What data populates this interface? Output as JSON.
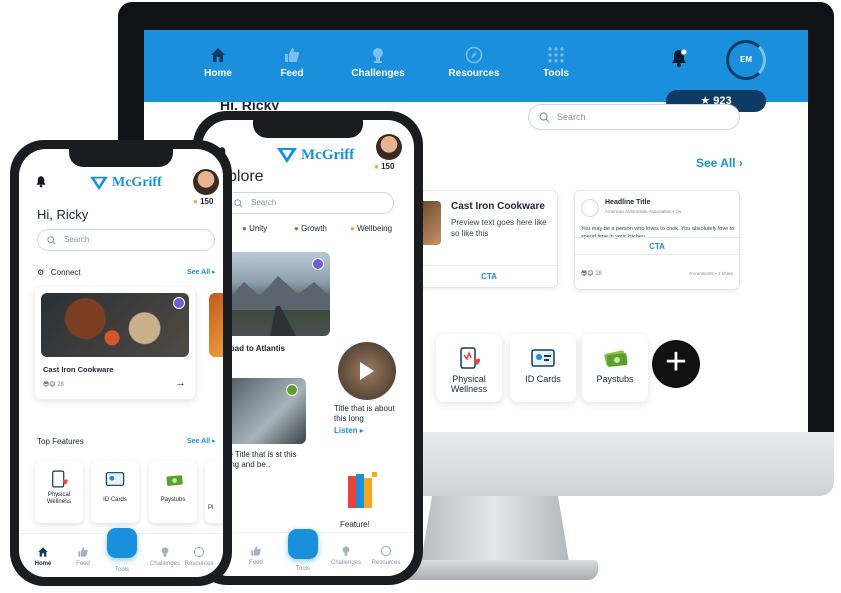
{
  "desktop": {
    "nav": [
      {
        "label": "Home",
        "icon": "home-icon"
      },
      {
        "label": "Feed",
        "icon": "thumbs-up-icon"
      },
      {
        "label": "Challenges",
        "icon": "trophy-icon"
      },
      {
        "label": "Resources",
        "icon": "compass-icon"
      },
      {
        "label": "Tools",
        "icon": "grid-icon"
      }
    ],
    "avatar_initials": "EM",
    "points": "923",
    "greeting_partial": "Hi, Ricky",
    "search_placeholder": "Search",
    "see_all": "See All",
    "card1": {
      "title": "Cast Iron Cookware",
      "preview": "Preview text goes here like so like this",
      "cta": "CTA"
    },
    "card2": {
      "headline": "Headline Title",
      "source": "American Automobile Association • 1w",
      "body": "You may be a person who loves to cook. You absolutely love to spend time in your kitchen...",
      "reaction_count": "28",
      "stats": "0 comments • 1 share",
      "cta": "CTA"
    },
    "features": [
      {
        "label": "Physical Wellness",
        "icon": "clipboard-heart-icon"
      },
      {
        "label": "ID Cards",
        "icon": "id-card-icon"
      },
      {
        "label": "Paystubs",
        "icon": "money-icon"
      }
    ],
    "plus_label": "+"
  },
  "phone_left": {
    "points": "150",
    "logo_text": "McGriff",
    "greeting": "Hi, Ricky",
    "search_placeholder": "Search",
    "connect_label": "Connect",
    "see_all": "See All",
    "card_title": "Cast Iron Cookware",
    "reaction_count": "28",
    "arrow": "→",
    "top_features_label": "Top Features",
    "features": [
      "Physical Wellness",
      "ID Cards",
      "Paystubs",
      "Pl"
    ],
    "tabs": [
      "Home",
      "Feed",
      "Tools",
      "Challenges",
      "Resources"
    ]
  },
  "phone_right": {
    "points": "150",
    "logo_text": "McGriff",
    "explore_title": "xplore",
    "search_placeholder": "Search",
    "filters": [
      "Unity",
      "Growth",
      "Wellbeing"
    ],
    "road_caption": "Road to Atlantis",
    "video_caption": "Title that is about this long",
    "listen": "Listen",
    "article_caption": "de Title that is st this long and be..",
    "feature_label": "Feature!",
    "tabs": [
      "Feed",
      "Tools",
      "Challenges",
      "Resources"
    ]
  },
  "colors": {
    "brand_blue": "#1a8fdc",
    "navy": "#0d3b66"
  }
}
